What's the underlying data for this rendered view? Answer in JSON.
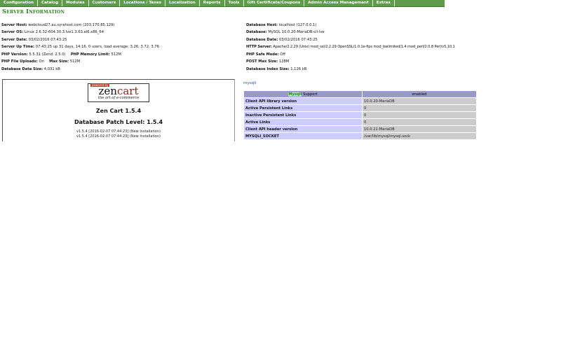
{
  "menu": [
    "Configuration",
    "Catalog",
    "Modules",
    "Customers",
    "Locations / Taxes",
    "Localization",
    "Reports",
    "Tools",
    "Gift Certificate/Coupons",
    "Admin Access Management",
    "Extras"
  ],
  "page_title": "Server Information",
  "left_info": {
    "server_host": {
      "label": "Server Host:",
      "value": "webcloud27.au.syrahost.com (203.170.85.129)"
    },
    "server_os": {
      "label": "Server OS:",
      "value": "Linux 2.6.32-604.30.3.lve1.3.63.el6.x86_64"
    },
    "server_date": {
      "label": "Server Date:",
      "value": "03/02/2016 07:43:25"
    },
    "server_uptime": {
      "label": "Server Up Time:",
      "value": "07:43:25 up 31 days, 14:16, 0 users, load average: 3.26, 3.72, 3.76"
    },
    "php_version": {
      "label": "PHP Version:",
      "value": "5.5.31 (Zend: 2.5.0)"
    },
    "php_memory": {
      "label": "PHP Memory Limit:",
      "value": "512M"
    },
    "php_uploads": {
      "label": "PHP File Uploads:",
      "value": "On"
    },
    "max_size": {
      "label": "Max Size:",
      "value": "512M"
    },
    "db_size": {
      "label": "Database Data Size:",
      "value": "4,031 kB"
    }
  },
  "right_info": {
    "db_host": {
      "label": "Database Host:",
      "value": "localhost (127.0.0.1)"
    },
    "database": {
      "label": "Database:",
      "value": "MySQL 10.0.20-MariaDB-cll-lve"
    },
    "db_date": {
      "label": "Database Date:",
      "value": "03/02/2016 07:43:25"
    },
    "http_server": {
      "label": "HTTP Server:",
      "value": "Apache/2.2.29 (Unix) mod_ssl/2.2.29 OpenSSL/1.0.1e-fips mod_bwlimited/1.4 mod_perl/2.0.8 Perl/v5.10.1"
    },
    "safe_mode": {
      "label": "PHP Safe Mode:",
      "value": "Off"
    },
    "post_max": {
      "label": "POST Max Size:",
      "value": "128M"
    },
    "db_index": {
      "label": "Database Index Size:",
      "value": "1,126 kB"
    }
  },
  "zen": {
    "logo_powered": "powered by",
    "logo_zen": "zen",
    "logo_cart": "cart",
    "logo_tagline": "the art of e-commerce",
    "version": "Zen Cart 1.5.4",
    "patch_level": "Database Patch Level: 1.5.4",
    "history": [
      "v1.5.4   [2016-02-07 07:44:23]   (New Installation)",
      "v1.5.4   [2016-02-07 07:44:23]   (New Installation)"
    ]
  },
  "mysqli": {
    "label": "mysqli",
    "header_highlight": "MysqlI",
    "header_rest": " Support",
    "header_value": "enabled",
    "rows": [
      {
        "key": "Client API library version",
        "value": "10.0.20-MariaDB"
      },
      {
        "key": "Active Persistent Links",
        "value": "0"
      },
      {
        "key": "Inactive Persistent Links",
        "value": "0"
      },
      {
        "key": "Active Links",
        "value": "0"
      },
      {
        "key": "Client API header version",
        "value": "10.0.21-MariaDB"
      },
      {
        "key": "MYSQLI_SOCKET",
        "value": "/var/lib/mysql/mysql.sock"
      }
    ]
  }
}
